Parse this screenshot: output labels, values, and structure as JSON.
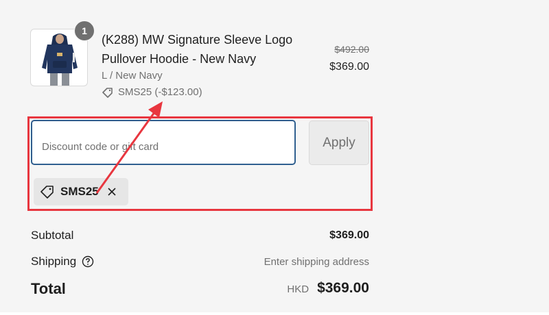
{
  "line_item": {
    "quantity": "1",
    "title": "(K288) MW Signature Sleeve Logo Pullover Hoodie - New Navy",
    "variant": "L / New Navy",
    "discount_applied": "SMS25 (-$123.00)",
    "original_price": "$492.00",
    "price": "$369.00",
    "image_icon": "hoodie-product-image"
  },
  "discount_form": {
    "placeholder": "Discount code or gift card",
    "apply_label": "Apply",
    "applied_code": "SMS25"
  },
  "totals": {
    "subtotal_label": "Subtotal",
    "subtotal_value": "$369.00",
    "shipping_label": "Shipping",
    "shipping_value": "Enter shipping address",
    "total_label": "Total",
    "currency": "HKD",
    "total_value": "$369.00"
  },
  "colors": {
    "annotation_red": "#e8363f",
    "input_border": "#2f5f8f",
    "panel_bg": "#f5f5f5",
    "muted_text": "#707070"
  }
}
